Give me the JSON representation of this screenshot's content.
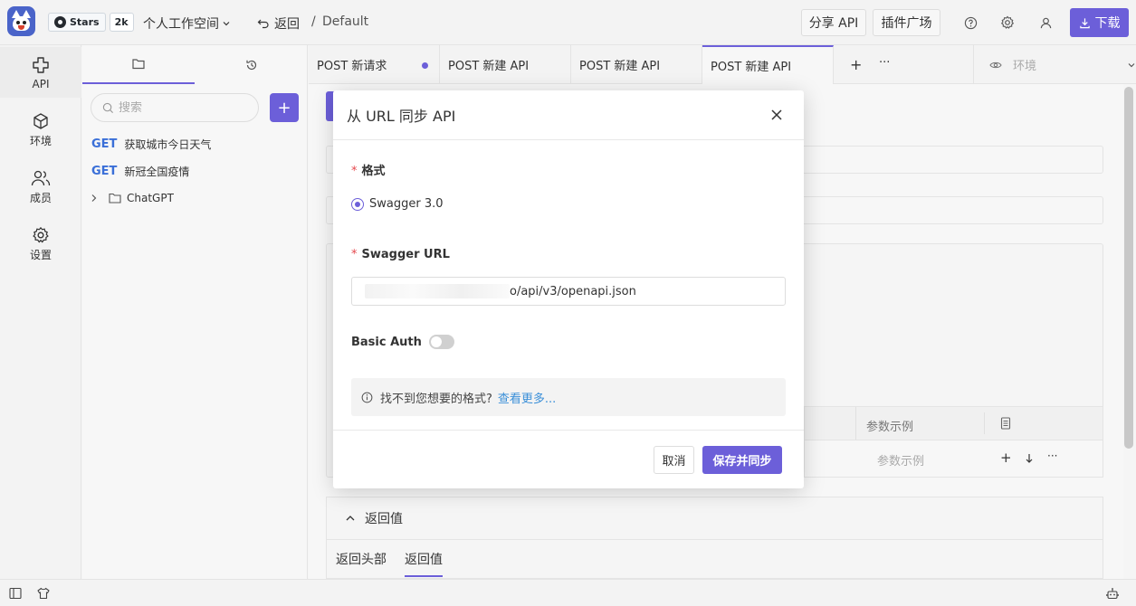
{
  "topbar": {
    "github": {
      "label": "Stars",
      "count": "2k"
    },
    "workspace": "个人工作空间",
    "back": "返回",
    "breadcrumb_sep": "/",
    "breadcrumb": "Default",
    "share": "分享 API",
    "plugins": "插件广场",
    "download": "下载"
  },
  "leftnav": {
    "items": [
      {
        "label": "API",
        "icon": "api-icon"
      },
      {
        "label": "环境",
        "icon": "cube-icon"
      },
      {
        "label": "成员",
        "icon": "users-icon"
      },
      {
        "label": "设置",
        "icon": "gear-icon"
      }
    ]
  },
  "sidebar": {
    "search_placeholder": "搜索",
    "add_label": "+",
    "apis": [
      {
        "method": "GET",
        "name": "获取城市今日天气"
      },
      {
        "method": "GET",
        "name": "新冠全国疫情"
      }
    ],
    "folder": "ChatGPT"
  },
  "reqtabs": {
    "tabs": [
      {
        "label": "POST 新请求"
      },
      {
        "label": "POST 新建 API"
      },
      {
        "label": "POST 新建 API"
      },
      {
        "label": "POST 新建 API"
      }
    ],
    "plus": "+",
    "more": "···",
    "env": "环境"
  },
  "background": {
    "param_example_header": "参数示例",
    "param_example_cell": "参数示例",
    "return_title": "返回值",
    "return_tabs": [
      "返回头部",
      "返回值"
    ]
  },
  "modal": {
    "title": "从 URL 同步 API",
    "format_label": "格式",
    "format_option": "Swagger 3.0",
    "url_label": "Swagger URL",
    "url_value": "o/api/v3/openapi.json",
    "basic_auth_label": "Basic Auth",
    "tip_text": "找不到您想要的格式?",
    "tip_link": "查看更多...",
    "cancel": "取消",
    "save": "保存并同步"
  }
}
